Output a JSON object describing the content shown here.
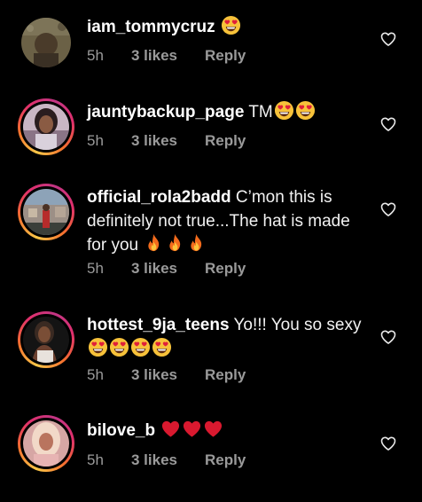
{
  "comments": [
    {
      "username": "iam_tommycruz",
      "text": "",
      "emoji": [
        "heart-eyes"
      ],
      "time": "5h",
      "likes": "3 likes",
      "reply": "Reply",
      "has_story_ring": false
    },
    {
      "username": "jauntybackup_page",
      "text": "TM",
      "emoji": [
        "heart-eyes",
        "heart-eyes"
      ],
      "time": "5h",
      "likes": "3 likes",
      "reply": "Reply",
      "has_story_ring": true
    },
    {
      "username": "official_rola2badd",
      "text": "C’mon this is definitely not true...The hat is made for you",
      "emoji": [
        "fire",
        "fire",
        "fire"
      ],
      "time": "5h",
      "likes": "3 likes",
      "reply": "Reply",
      "has_story_ring": true
    },
    {
      "username": "hottest_9ja_teens",
      "text": "Yo!!! You so sexy",
      "emoji": [
        "heart-eyes",
        "heart-eyes",
        "heart-eyes",
        "heart-eyes"
      ],
      "time": "5h",
      "likes": "3 likes",
      "reply": "Reply",
      "has_story_ring": true
    },
    {
      "username": "bilove_b",
      "text": "",
      "emoji": [
        "red-heart",
        "red-heart",
        "red-heart"
      ],
      "time": "5h",
      "likes": "3 likes",
      "reply": "Reply",
      "has_story_ring": true
    }
  ],
  "colors": {
    "background": "#000000",
    "meta_text": "#9a9a9a",
    "emoji_heart_red": "#e0203a",
    "emoji_face_yellow": "#f7c23a",
    "fire_orange": "#f36b1c"
  }
}
